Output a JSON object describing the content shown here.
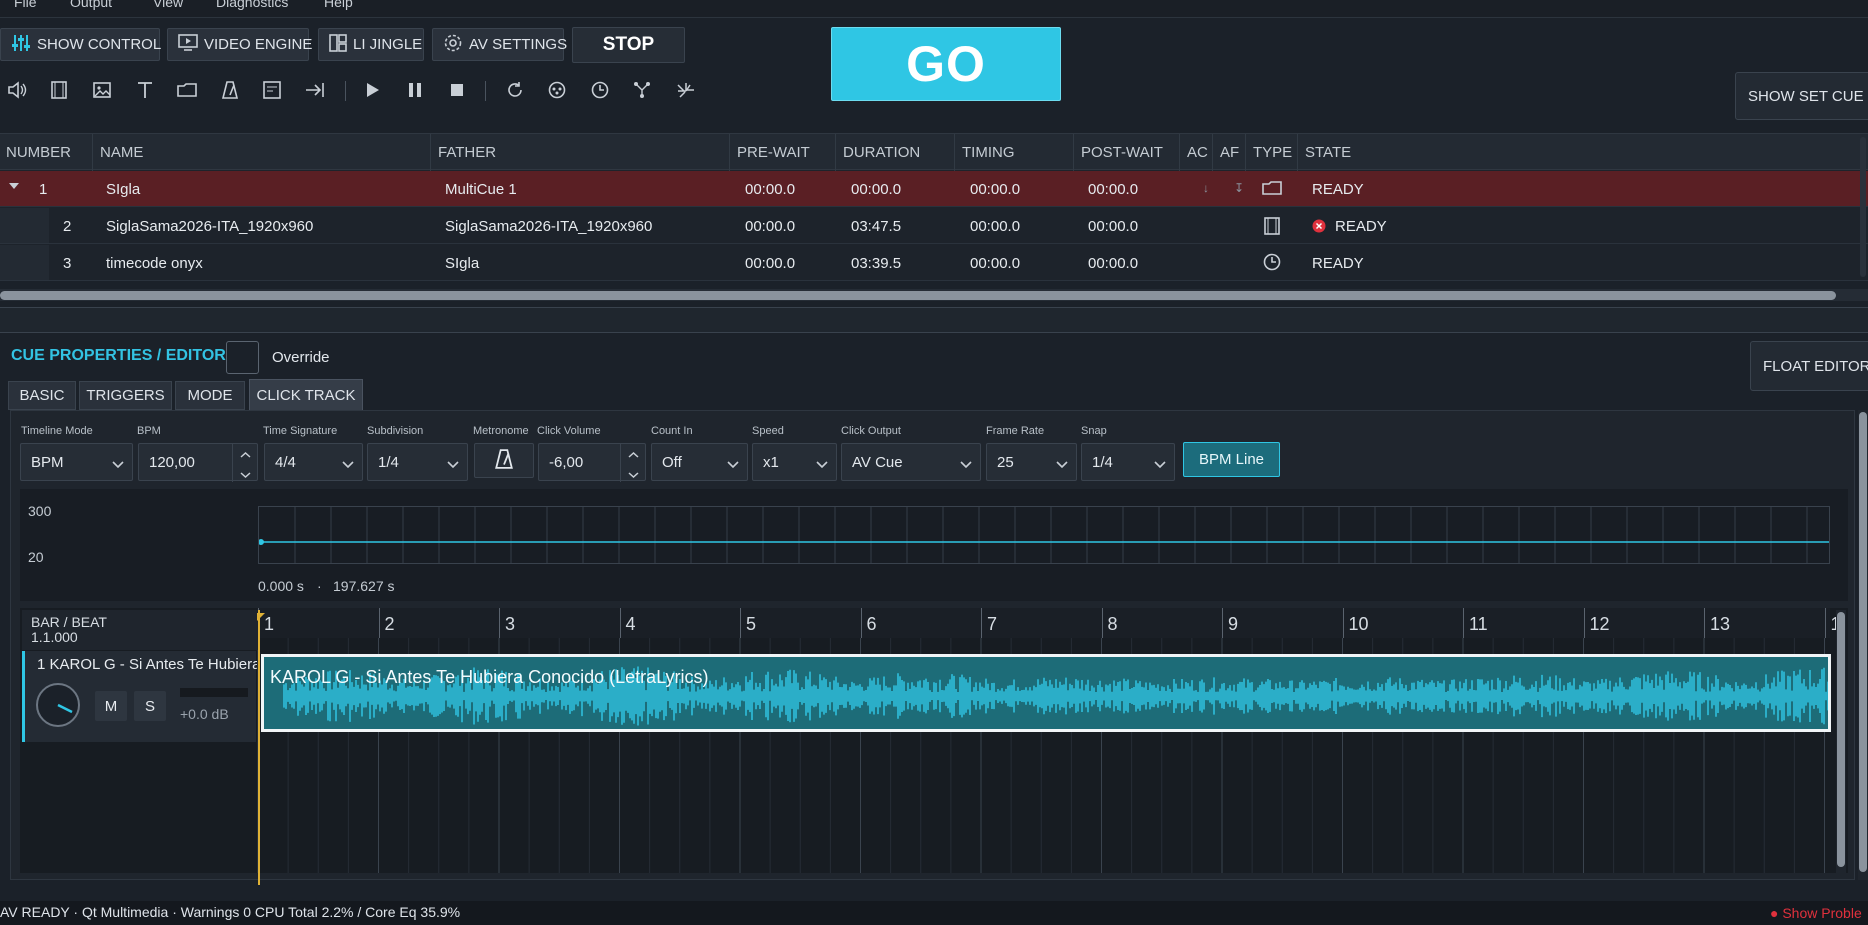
{
  "menu": [
    "File",
    "Output",
    "View",
    "Diagnostics",
    "Help"
  ],
  "toolbar": {
    "show_control": "SHOW CONTROL",
    "video_engine": "VIDEO ENGINE",
    "li_jingle": "LI JINGLE",
    "av_settings": "AV SETTINGS",
    "stop": "STOP",
    "go": "GO",
    "show_set_cue_list": "SHOW SET CUE LIS"
  },
  "cue_icons": [
    "volume-icon",
    "film-icon",
    "image-icon",
    "text-icon",
    "folder-icon",
    "metronome-icon",
    "list-icon",
    "goto-icon",
    "play-icon",
    "pause-icon",
    "stop-icon",
    "reload-icon",
    "network-icon",
    "clock-icon",
    "graph-icon",
    "dmx-icon"
  ],
  "grid": {
    "columns": [
      "NUMBER",
      "NAME",
      "FATHER",
      "PRE-WAIT",
      "DURATION",
      "TIMING",
      "POST-WAIT",
      "AC",
      "AF",
      "TYPE",
      "STATE"
    ],
    "rows": [
      {
        "number": "1",
        "name": "SIgla",
        "father": "MultiCue 1",
        "prewait": "00:00.0",
        "duration": "00:00.0",
        "timing": "00:00.0",
        "postwait": "00:00.0",
        "ac": "↓",
        "af": "↧",
        "type": "folder-icon",
        "state": "READY",
        "error": false,
        "selected": true,
        "expanded": true
      },
      {
        "number": "2",
        "name": "SiglaSama2026-ITA_1920x960",
        "father": "SiglaSama2026-ITA_1920x960",
        "prewait": "00:00.0",
        "duration": "03:47.5",
        "timing": "00:00.0",
        "postwait": "00:00.0",
        "ac": "",
        "af": "",
        "type": "film-icon",
        "state": "READY",
        "error": true,
        "selected": false
      },
      {
        "number": "3",
        "name": "timecode onyx",
        "father": "SIgla",
        "prewait": "00:00.0",
        "duration": "03:39.5",
        "timing": "00:00.0",
        "postwait": "00:00.0",
        "ac": "",
        "af": "",
        "type": "clock-icon",
        "state": "READY",
        "error": false,
        "selected": false
      }
    ]
  },
  "editor": {
    "title": "CUE PROPERTIES / EDITOR",
    "override": "Override",
    "float_editor": "FLOAT EDITOR",
    "tabs": [
      "BASIC",
      "TRIGGERS",
      "MODE",
      "CLICK TRACK"
    ],
    "active_tab": "CLICK TRACK"
  },
  "click": {
    "labels": {
      "timeline_mode": "Timeline Mode",
      "bpm": "BPM",
      "time_signature": "Time Signature",
      "subdivision": "Subdivision",
      "metronome": "Metronome",
      "click_volume": "Click Volume",
      "count_in": "Count In",
      "speed": "Speed",
      "click_output": "Click Output",
      "frame_rate": "Frame Rate",
      "snap": "Snap"
    },
    "values": {
      "timeline_mode": "BPM",
      "bpm": "120,00",
      "time_signature": "4/4",
      "subdivision": "1/4",
      "click_volume": "-6,00",
      "count_in": "Off",
      "speed": "x1",
      "click_output": "AV Cue",
      "frame_rate": "25",
      "snap": "1/4"
    },
    "bpm_line": "BPM Line"
  },
  "tempo": {
    "max": "300",
    "min": "20",
    "start": "0.000 s",
    "dot": "·",
    "end": "197.627 s",
    "bpm_value": 120
  },
  "timeline": {
    "bar_beat_label": "BAR / BEAT",
    "position": "1.1.000",
    "bars": [
      "1",
      "2",
      "3",
      "4",
      "5",
      "6",
      "7",
      "8",
      "9",
      "10",
      "11",
      "12",
      "13",
      "1"
    ],
    "track_name": "1  KAROL G - Si Antes Te Hubiera",
    "mute": "M",
    "solo": "S",
    "gain": "+0.0 dB",
    "clip_label": "KAROL G - Si Antes Te Hubiera Conocido (LetraLyrics)"
  },
  "status": {
    "text": "AV READY · Qt Multimedia · Warnings 0 CPU Total 2.2% / Core Eq 35.9%",
    "problems": "● Show Proble"
  },
  "colors": {
    "accent": "#2fc6e4",
    "selected_row": "#5a1f24",
    "error": "#e0313d",
    "playhead": "#e0b236"
  }
}
